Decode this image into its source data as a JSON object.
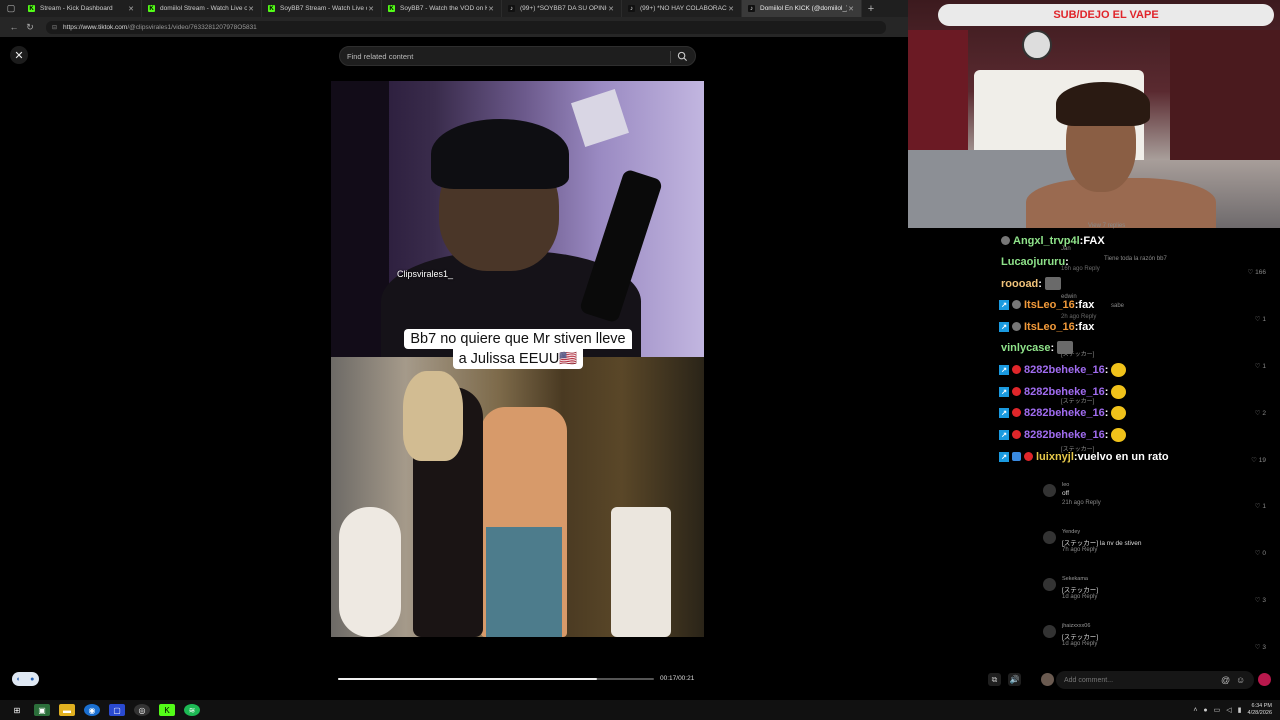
{
  "browser": {
    "tabs": [
      {
        "label": "Stream - Kick Dashboard",
        "favicon": "kick-icon",
        "active": false
      },
      {
        "label": "domiilol Stream - Watch Live on Kick",
        "favicon": "kick-icon",
        "active": false
      },
      {
        "label": "SoyBB7 Stream - Watch Live on Kick",
        "favicon": "kick-icon",
        "active": false
      },
      {
        "label": "SoyBB7 - Watch the VOD on Kick",
        "favicon": "kick-icon",
        "active": false
      },
      {
        "label": "(99+) *SOYBB7 DA SU OPINIÓN* K",
        "favicon": "tiktok-icon",
        "active": false
      },
      {
        "label": "(99+) *NO HAY COLABORACIÓN",
        "favicon": "tiktok-icon",
        "active": false
      },
      {
        "label": "Domiilol En KICK (@domiilol_) | T",
        "favicon": "tiktok-icon",
        "active": true
      }
    ],
    "url_host": "https://www.tiktok.com",
    "url_path": "/@clipsvirales1/video/7633281207978O5831"
  },
  "page": {
    "search_placeholder": "Find related content",
    "watermark": "Clipsvirales1_",
    "caption_line1": "Bb7 no quiere que Mr stiven lleve",
    "caption_line2": "a Julissa   EEUU🇺🇸",
    "time": "00:17/00:21",
    "progress_fraction": 0.82
  },
  "webcam": {
    "banner": "SUB/DEJO EL VAPE"
  },
  "chat": {
    "lines": [
      {
        "user": "Angxl_trvp4l",
        "sep": " : ",
        "msg": "FAX",
        "color": "#8fe38a",
        "badges": [
          "grey"
        ]
      },
      {
        "user": "Lucaojururu",
        "sep": " : ",
        "msg": "",
        "color": "#8fe38a",
        "badges": []
      },
      {
        "user": "roooad",
        "sep": " : ",
        "msg": "",
        "color": "#f0c27a",
        "badges": [],
        "sticker": true
      },
      {
        "user": "ItsLeo_16",
        "sep": " : ",
        "msg": "fax",
        "color": "#f29a3a",
        "badges": [
          "twitch",
          "grey"
        ]
      },
      {
        "user": "ItsLeo_16",
        "sep": " : ",
        "msg": "fax",
        "color": "#f29a3a",
        "badges": [
          "twitch",
          "grey"
        ]
      },
      {
        "user": "vinlycase",
        "sep": " : ",
        "msg": "",
        "color": "#8fe38a",
        "badges": [],
        "sticker": true
      },
      {
        "user": "8282beheke_16",
        "sep": " : ",
        "msg": "",
        "color": "#a06cf0",
        "badges": [
          "twitch",
          "red"
        ],
        "emote": true
      },
      {
        "user": "8282beheke_16",
        "sep": " : ",
        "msg": "",
        "color": "#a06cf0",
        "badges": [
          "twitch",
          "red"
        ],
        "emote": true
      },
      {
        "user": "8282beheke_16",
        "sep": " : ",
        "msg": "",
        "color": "#a06cf0",
        "badges": [
          "twitch",
          "red"
        ],
        "emote": true
      },
      {
        "user": "8282beheke_16",
        "sep": " : ",
        "msg": "",
        "color": "#a06cf0",
        "badges": [
          "twitch",
          "red"
        ],
        "emote": true
      },
      {
        "user": "luixnyjl",
        "sep": " : ",
        "msg": "vuelvo en un rato",
        "color": "#e6c84a",
        "badges": [
          "twitch",
          "blue",
          "red"
        ]
      }
    ],
    "ghost": {
      "top_replies": "View 7 replies",
      "jan": "Jan",
      "tiene": "Tiene toda la razón bb7",
      "r1_meta": "16h ago   Reply",
      "likes_166": "166",
      "edwin": "edwin",
      "sabe": "sabe",
      "r2_meta": "2h ago   Reply",
      "likes_1a": "1",
      "sticker1": "[ステッカー]",
      "likes_1b": "1",
      "sticker2": "[ステッカー]",
      "likes_2": "2",
      "sticker3": "[ステッカー]",
      "likes_19": "19"
    },
    "comments": [
      {
        "name": "leo",
        "text": "off",
        "meta": "21h ago   Reply",
        "likes": "1"
      },
      {
        "name": "Yendey",
        "text": "[ステッカー] la nv de stiven",
        "meta": "7h ago   Reply",
        "likes": "0"
      },
      {
        "name": "Sekekama",
        "text": "[ステッカー]",
        "meta": "1d ago   Reply",
        "likes": "3"
      },
      {
        "name": "jhaizxxxx06",
        "text": "[ステッカー]",
        "meta": "1d ago   Reply",
        "likes": "3"
      }
    ],
    "comment_placeholder": "Add comment..."
  },
  "taskbar": {
    "time": "6:34 PM",
    "date": "4/28/2026"
  }
}
